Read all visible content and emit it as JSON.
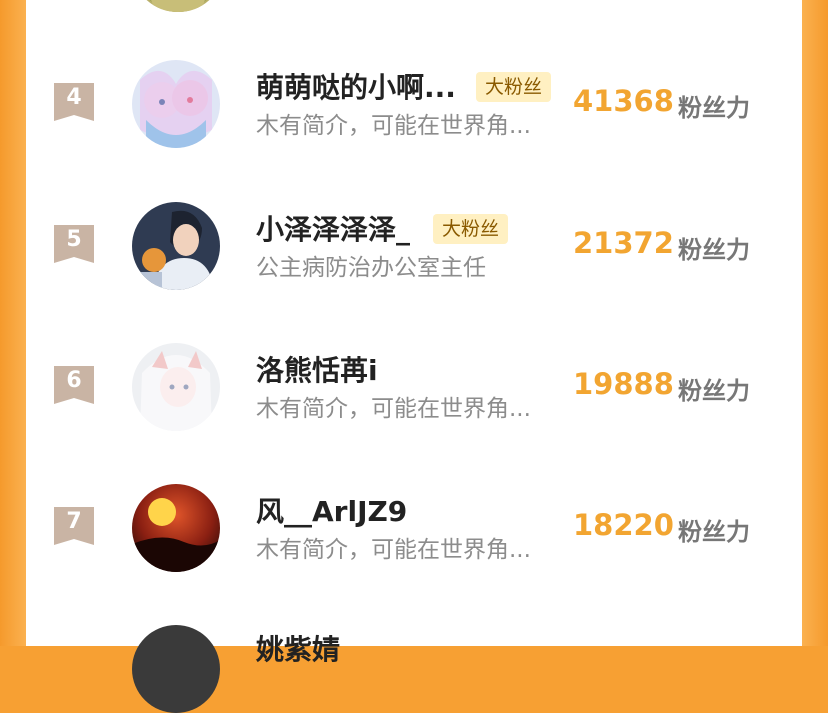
{
  "score_unit_label": "粉丝力",
  "fan_badge_label": "大粉丝",
  "rows": [
    {
      "rank": "4",
      "name": "萌萌哒的小啊...",
      "bio": "木有简介，可能在世界角...",
      "score": "41368",
      "has_badge": true
    },
    {
      "rank": "5",
      "name": "小泽泽泽泽_",
      "bio": "公主病防治办公室主任",
      "score": "21372",
      "has_badge": true
    },
    {
      "rank": "6",
      "name": "洛熊恬苒i",
      "bio": "木有简介，可能在世界角...",
      "score": "19888",
      "has_badge": false
    },
    {
      "rank": "7",
      "name": "风__ArlJZ9",
      "bio": "木有简介，可能在世界角...",
      "score": "18220",
      "has_badge": false
    }
  ],
  "partial_next_name": "姚紫婧",
  "colors": {
    "frame": "#f7a033",
    "score": "#f2a531",
    "badge_bg": "#fff0c2",
    "rank_badge": "#c9b4a4"
  }
}
